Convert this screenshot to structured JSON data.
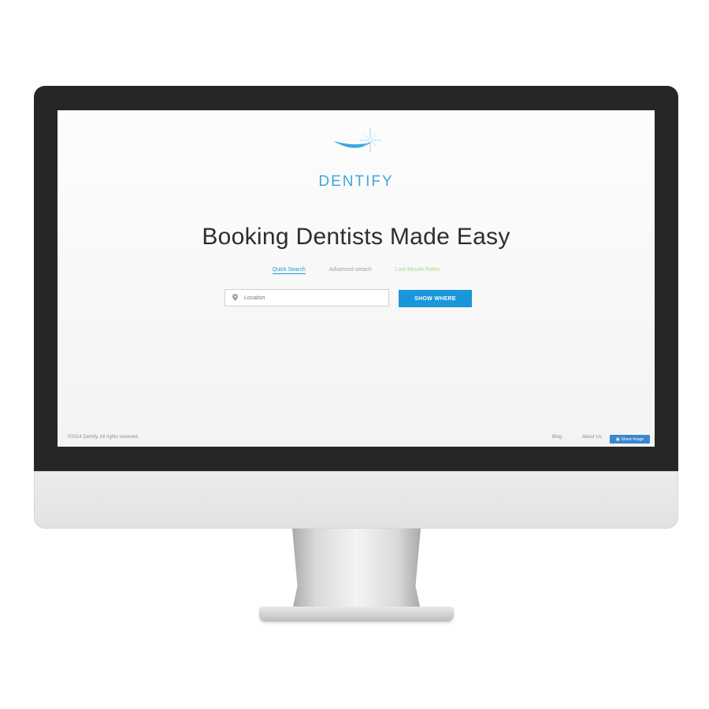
{
  "brand": {
    "name": "DENTIFY",
    "color": "#3aa9dd"
  },
  "hero": {
    "headline": "Booking Dentists Made Easy"
  },
  "tabs": [
    {
      "label": "Quick Search",
      "active": true
    },
    {
      "label": "Advanced serach",
      "active": false
    },
    {
      "label": "Last Minute Rates",
      "active": false
    }
  ],
  "search": {
    "placeholder": "Location",
    "value": "",
    "button_label": "SHOW WHERE",
    "icon": "map-pin-icon"
  },
  "footer": {
    "copyright": "©2014 Dentify. All rights reserved",
    "blog": "Blog",
    "about": "About Us",
    "share_label": "Share Image",
    "share_icon": "image-icon"
  },
  "colors": {
    "accent": "#1a96db",
    "tab_last": "#a6d98a",
    "share": "#3a86d0"
  }
}
